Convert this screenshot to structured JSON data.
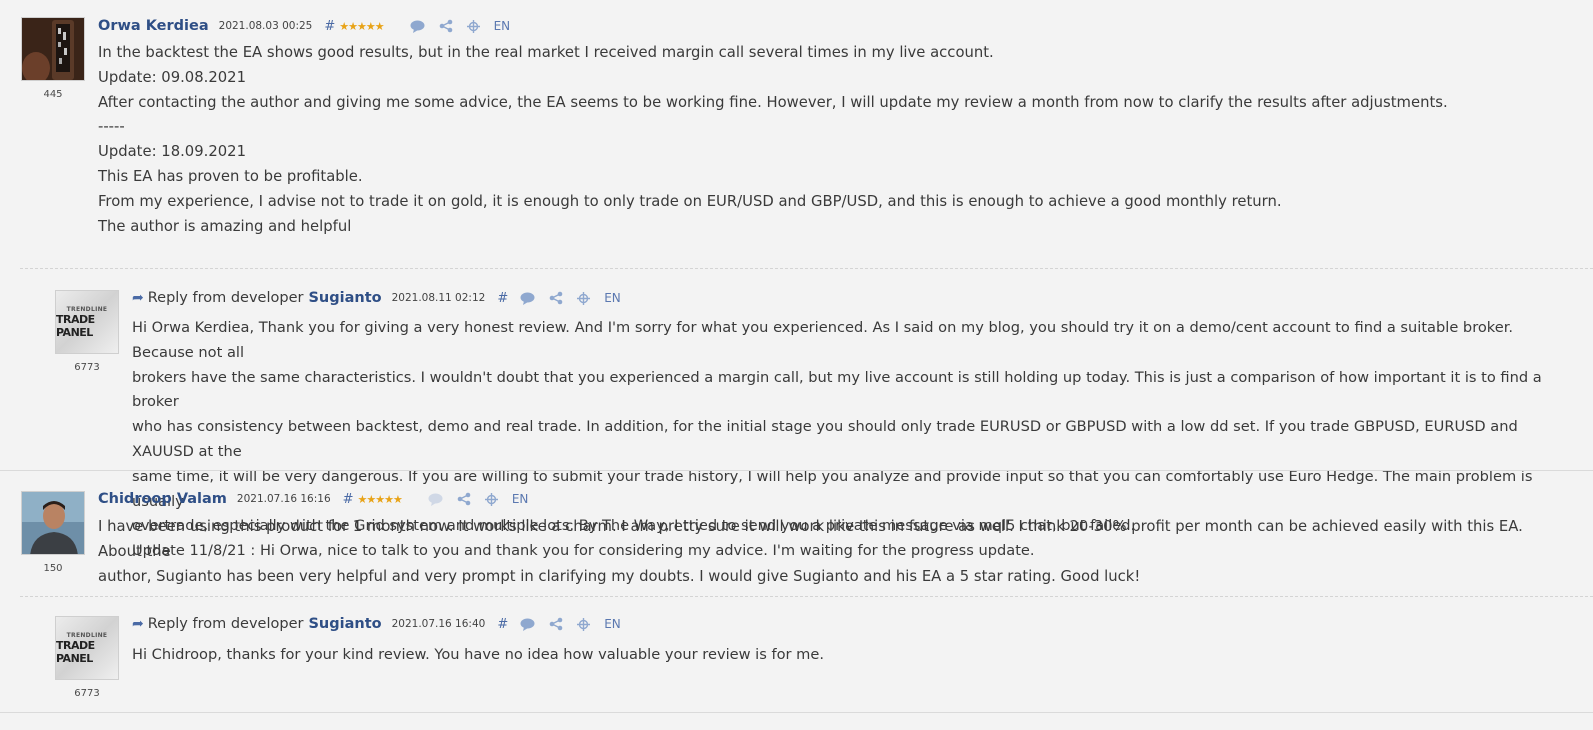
{
  "colors": {
    "author": "#2f4f86",
    "stars": "#e8a317",
    "background": "#f3f3f3"
  },
  "icons": [
    "comment-icon",
    "share-icon",
    "crosshair-icon"
  ],
  "reviews": [
    {
      "author": "Orwa Kerdiea",
      "date": "2021.08.03 00:25",
      "hash": "#",
      "stars": "★★★★★",
      "rating_count": "445",
      "lang": "EN",
      "lines": [
        "In the backtest the EA shows good results, but in the real market I received margin call several times in my live account.",
        "Update: 09.08.2021",
        "After contacting the author and giving me some advice, the EA seems to be working fine. However, I will update my review a month from now to clarify the results after adjustments.",
        "-----",
        "Update: 18.09.2021",
        "This EA has proven to be profitable.",
        "From my experience, I advise not to trade it on gold, it is enough to only trade on EUR/USD and GBP/USD, and this is enough to achieve a good monthly return.",
        "The author is amazing and helpful"
      ],
      "reply": {
        "label": "Reply from developer",
        "developer": "Sugianto",
        "date": "2021.08.11 02:12",
        "hash": "#",
        "lang": "EN",
        "rating_count": "6773",
        "logo_top": "TRENDLINE",
        "logo_main": "TRADE PANEL",
        "lines": [
          "Hi Orwa Kerdiea, Thank you for giving a very honest review. And I'm sorry for what you experienced. As I said on my blog, you should try it on a demo/cent account to find a suitable broker. Because not all",
          "brokers have the same characteristics. I wouldn't doubt that you experienced a margin call, but my live account is still holding up today. This is just a comparison of how important it is to find a broker",
          "who has consistency between backtest, demo and real trade. In addition, for the initial stage you should only trade EURUSD or GBPUSD with a low dd set. If you trade GBPUSD, EURUSD and XAUUSD at the",
          "same time, it will be very dangerous. If you are willing to submit your trade history, I will help you analyze and provide input so that you can comfortably use Euro Hedge. The main problem is usually",
          "overtrade, especially with the Grid system and multiple lots. By The Way, I tried to send you a private message via mql5 chat, but failed.",
          "Update 11/8/21 : Hi Orwa, nice to talk to you and thank you for considering my advice. I'm waiting for the progress update."
        ]
      }
    },
    {
      "author": "Chidroop Valam",
      "date": "2021.07.16 16:16",
      "hash": "#",
      "stars": "★★★★★",
      "rating_count": "150",
      "lang": "EN",
      "lines": [
        "I have been using this product for 1 month now. It works like a charm. I am pretty sure it will work like this in future as well. I think 20-30% profit per month can be achieved easily with this EA. About the",
        "author, Sugianto has been very helpful and very prompt in clarifying my doubts. I would give Sugianto and his EA a 5 star rating. Good luck!"
      ],
      "reply": {
        "label": "Reply from developer",
        "developer": "Sugianto",
        "date": "2021.07.16 16:40",
        "hash": "#",
        "lang": "EN",
        "rating_count": "6773",
        "logo_top": "TRENDLINE",
        "logo_main": "TRADE PANEL",
        "lines": [
          "Hi Chidroop, thanks for your kind review. You have no idea how valuable your review is for me."
        ]
      }
    }
  ]
}
